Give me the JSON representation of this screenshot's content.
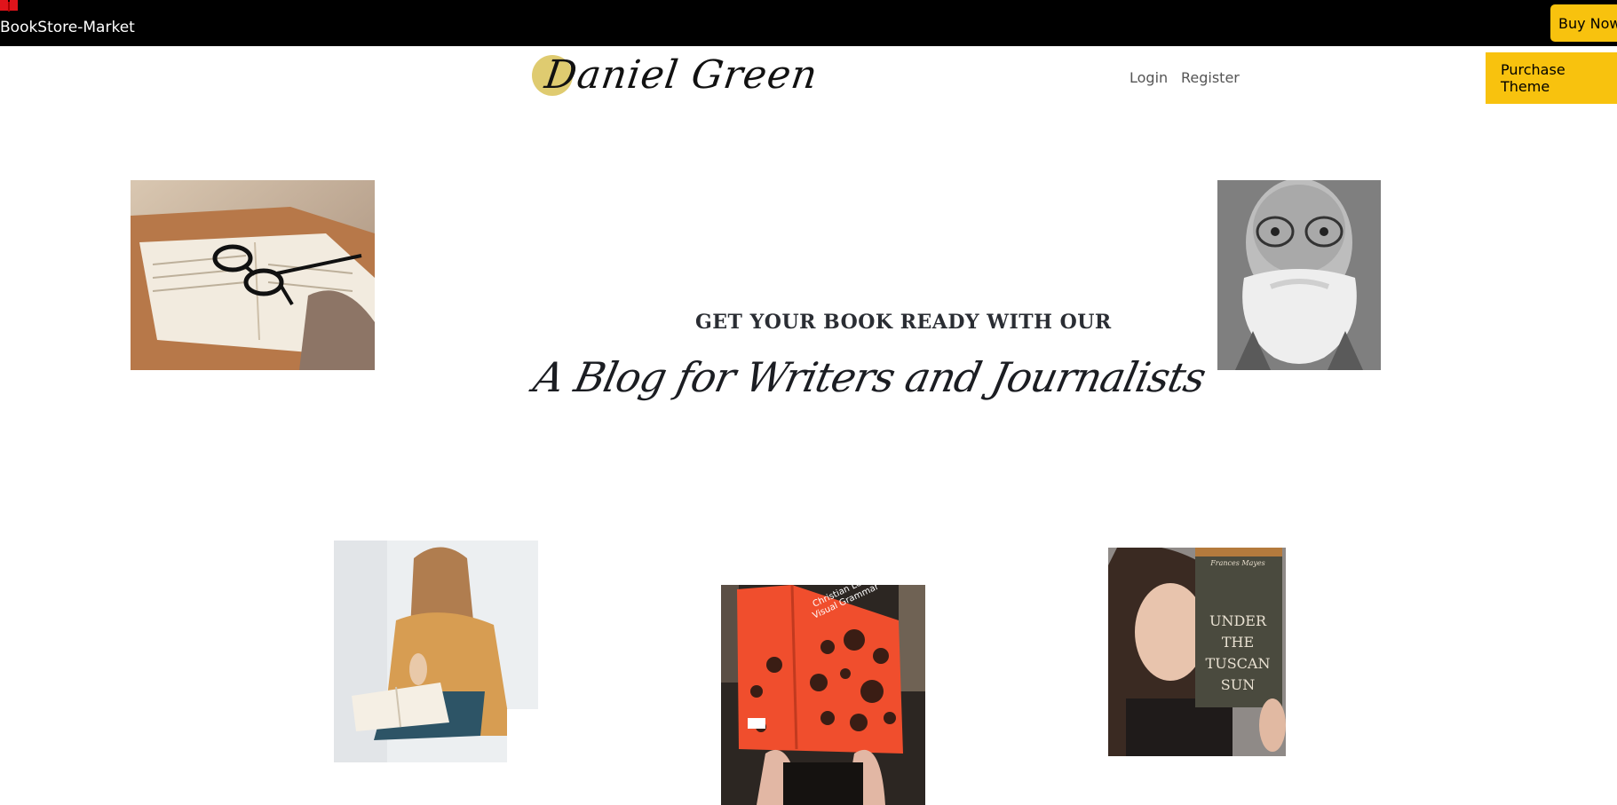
{
  "topbar": {
    "brand_label": "BookStore-Market",
    "buy_now_label": "Buy Now",
    "icon": "book-icon",
    "icon_color": "#e0141b",
    "button_color": "#f8c20e"
  },
  "header": {
    "logo_text": "Daniel Green",
    "nav": {
      "login_label": "Login",
      "register_label": "Register"
    },
    "purchase_label": "Purchase Theme"
  },
  "hero": {
    "kicker": "GET YOUR BOOK READY WITH OUR",
    "headline": "A Blog for Writers and Journalists"
  },
  "photos": {
    "book_glasses": "book-with-glasses-photo",
    "old_man": "bearded-old-man-portrait-photo",
    "woman_reading": "woman-reading-photo",
    "red_book": "red-book-cover-photo",
    "tuscan_sun": "woman-holding-book-photo",
    "tuscan_book_text": "UNDER THE TUSCAN SUN",
    "tuscan_author": "Frances Mayes",
    "red_book_title": "Christian Leborg Visual Grammar"
  }
}
